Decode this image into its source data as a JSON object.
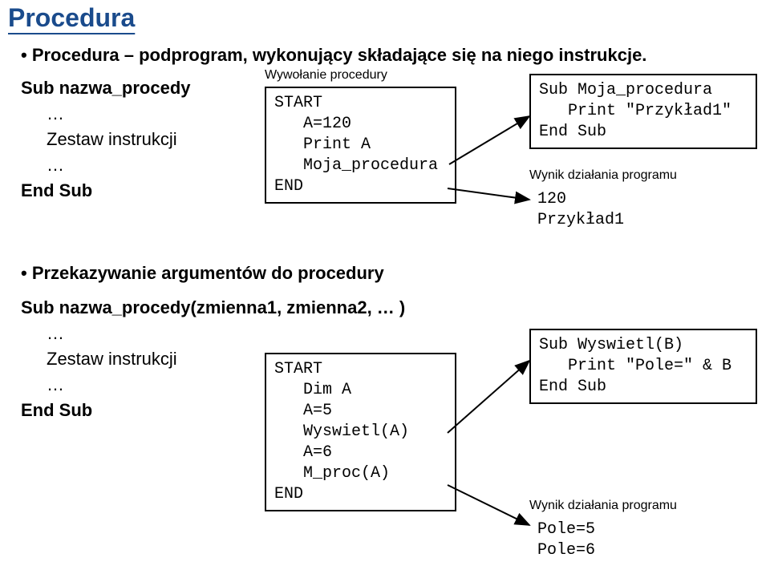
{
  "title": "Procedura",
  "subtitle": "• Procedura – podprogram, wykonujący składające się na niego instrukcje.",
  "decl1": {
    "line1": "Sub nazwa_procedy",
    "dots1": "…",
    "body": "Zestaw instrukcji",
    "dots2": "…",
    "line3": "End Sub"
  },
  "call_label": "Wywołanie procedury",
  "call1": "START\n   A=120\n   Print A\n   Moja_procedura\nEND",
  "sub1": "Sub Moja_procedura\n   Print \"Przykład1\"\nEnd Sub",
  "result_label": "Wynik działania programu",
  "result1": "120\nPrzykład1",
  "bullet2": "• Przekazywanie argumentów do procedury",
  "decl2": {
    "line1": "Sub nazwa_procedy(zmienna1, zmienna2, … )",
    "dots1": "…",
    "body": "Zestaw instrukcji",
    "dots2": "…",
    "line3": "End Sub"
  },
  "call2": "START\n   Dim A\n   A=5\n   Wyswietl(A)\n   A=6\n   M_proc(A)\nEND",
  "sub2": "Sub Wyswietl(B)\n   Print \"Pole=\" & B\nEnd Sub",
  "result2": "Pole=5\nPole=6"
}
